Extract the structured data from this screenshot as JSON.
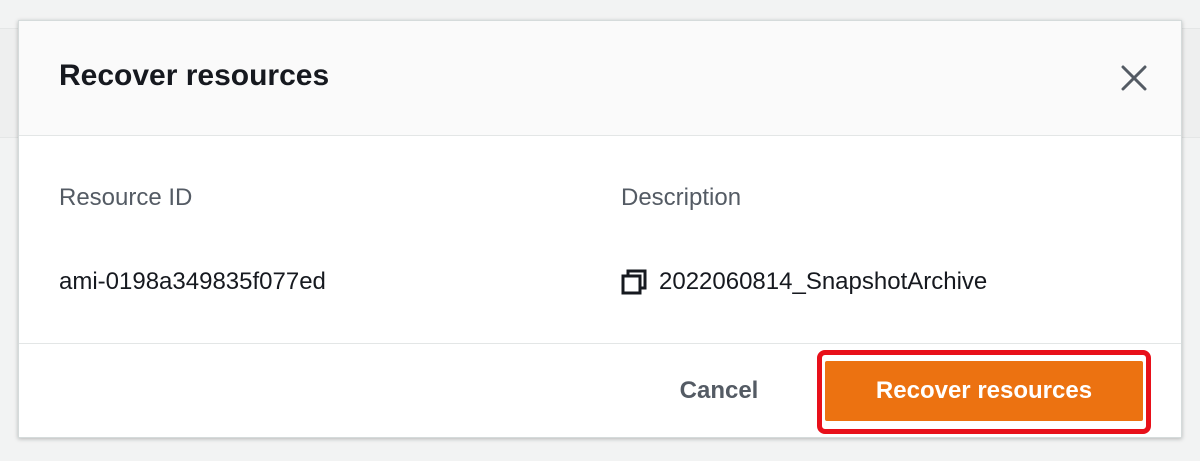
{
  "modal": {
    "title": "Recover resources",
    "close_icon": "close-icon"
  },
  "table": {
    "headers": [
      "Resource ID",
      "Description"
    ],
    "rows": [
      {
        "resource_id": "ami-0198a349835f077ed",
        "description": "2022060814_SnapshotArchive",
        "description_icon": "copy-icon"
      }
    ]
  },
  "footer": {
    "cancel_label": "Cancel",
    "primary_label": "Recover resources"
  },
  "colors": {
    "primary_button": "#ec7211",
    "highlight_border": "#e8101a",
    "text_primary": "#16191f",
    "text_secondary": "#545b64"
  }
}
